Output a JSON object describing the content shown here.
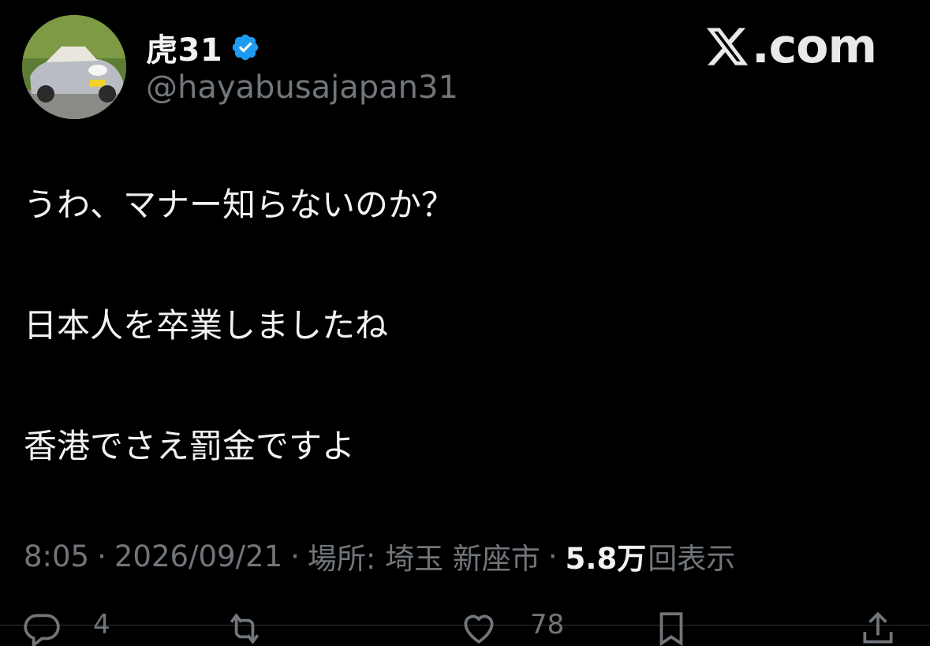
{
  "user": {
    "display_name": "虎31",
    "handle": "@hayabusajapan31",
    "verified": true,
    "verified_color": "#1d9bf0"
  },
  "brand": {
    "text": ".com"
  },
  "tweet": {
    "lines": [
      "うわ、マナー知らないのか？",
      "日本人を卒業しましたね",
      "香港でさえ罰金ですよ"
    ]
  },
  "meta": {
    "time": "8:05",
    "date": "2026/09/21",
    "location": "場所: 埼玉 新座市",
    "views_count": "5.8万",
    "views_label": "回表示",
    "separator": "·"
  },
  "actions": {
    "reply_count": "4",
    "like_count": "78"
  },
  "icons": [
    "avatar",
    "verified-badge-icon",
    "x-logo-icon",
    "reply-icon",
    "retweet-icon",
    "like-icon",
    "bookmark-icon",
    "share-icon"
  ]
}
